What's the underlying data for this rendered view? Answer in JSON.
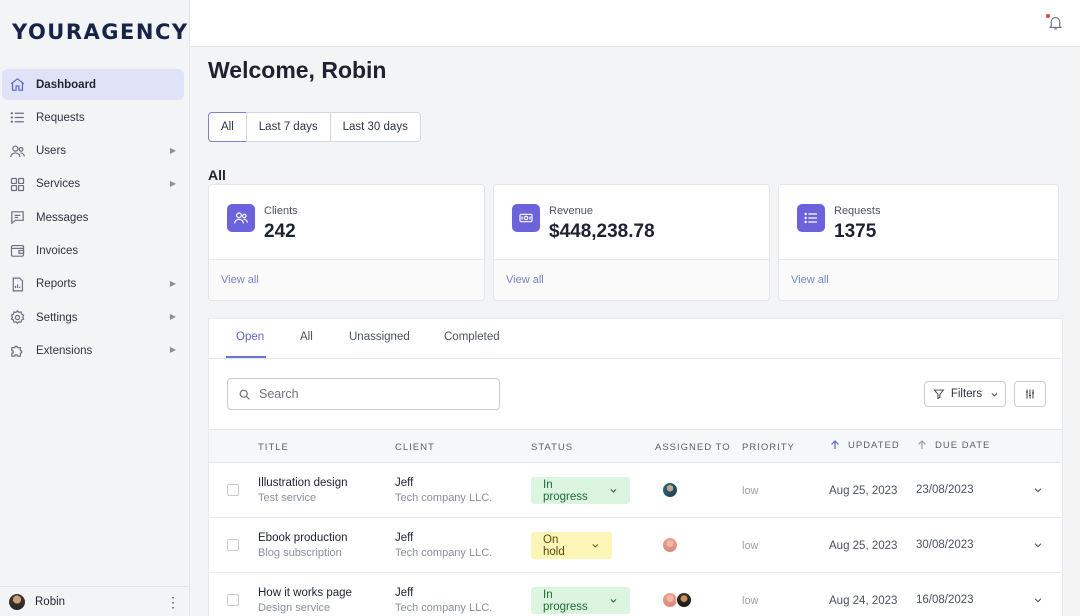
{
  "app": {
    "logo": "YOURAGENCY"
  },
  "sidebar": {
    "items": [
      {
        "label": "Dashboard",
        "icon": "home-icon",
        "active": true,
        "has_submenu": false
      },
      {
        "label": "Requests",
        "icon": "list-icon",
        "active": false,
        "has_submenu": false
      },
      {
        "label": "Users",
        "icon": "users-icon",
        "active": false,
        "has_submenu": true
      },
      {
        "label": "Services",
        "icon": "grid-icon",
        "active": false,
        "has_submenu": true
      },
      {
        "label": "Messages",
        "icon": "chat-icon",
        "active": false,
        "has_submenu": false
      },
      {
        "label": "Invoices",
        "icon": "wallet-icon",
        "active": false,
        "has_submenu": false
      },
      {
        "label": "Reports",
        "icon": "report-icon",
        "active": false,
        "has_submenu": true
      },
      {
        "label": "Settings",
        "icon": "gear-icon",
        "active": false,
        "has_submenu": true
      },
      {
        "label": "Extensions",
        "icon": "puzzle-icon",
        "active": false,
        "has_submenu": true
      }
    ],
    "submenu_glyph": "▶",
    "user": {
      "name": "Robin",
      "menu_glyph": "⋮"
    }
  },
  "header": {
    "welcome": "Welcome, Robin"
  },
  "range": {
    "options": [
      "All",
      "Last 7 days",
      "Last 30 days"
    ],
    "selected": "All"
  },
  "section_label": "All",
  "stats": [
    {
      "label": "Clients",
      "value": "242",
      "link": "View all",
      "icon": "users-icon"
    },
    {
      "label": "Revenue",
      "value": "$448,238.78",
      "link": "View all",
      "icon": "cash-icon"
    },
    {
      "label": "Requests",
      "value": "1375",
      "link": "View all",
      "icon": "list-icon"
    }
  ],
  "requests": {
    "tabs": [
      "Open",
      "All",
      "Unassigned",
      "Completed"
    ],
    "active_tab": "Open",
    "search_placeholder": "Search",
    "filters_label": "Filters",
    "columns": [
      "TITLE",
      "CLIENT",
      "STATUS",
      "ASSIGNED TO",
      "PRIORITY",
      "UPDATED",
      "DUE DATE"
    ],
    "rows": [
      {
        "title": "Illustration design",
        "service": "Test service",
        "client": "Jeff",
        "company": "Tech company LLC.",
        "status": "In progress",
        "priority": "low",
        "updated": "Aug 25, 2023",
        "due": "23/08/2023"
      },
      {
        "title": "Ebook production",
        "service": "Blog subscription",
        "client": "Jeff",
        "company": "Tech company LLC.",
        "status": "On hold",
        "priority": "low",
        "updated": "Aug 25, 2023",
        "due": "30/08/2023"
      },
      {
        "title": "How it works page",
        "service": "Design service",
        "client": "Jeff",
        "company": "Tech company LLC.",
        "status": "In progress",
        "priority": "low",
        "updated": "Aug 24, 2023",
        "due": "16/08/2023"
      }
    ]
  },
  "colors": {
    "accent": "#6b63dc",
    "active_nav_bg": "#e0e2f7",
    "in_progress_bg": "#dcf5e1",
    "on_hold_bg": "#fbf5b8",
    "link": "#7a82c9"
  }
}
